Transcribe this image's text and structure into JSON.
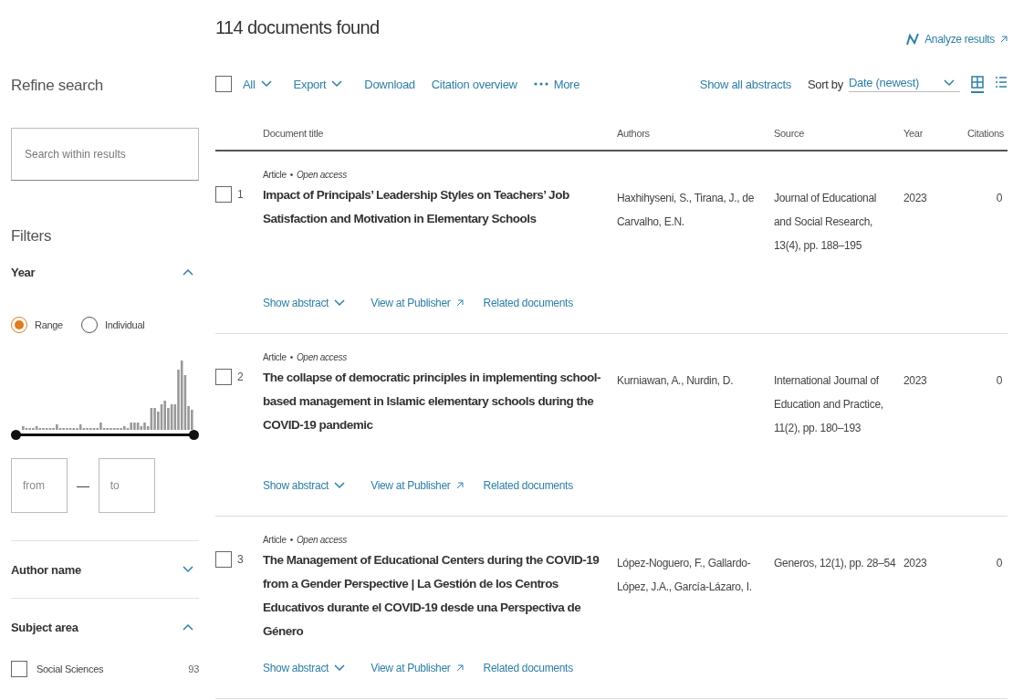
{
  "header": {
    "count": "114 documents found",
    "analyze": "Analyze results"
  },
  "sidebar": {
    "title": "Refine search",
    "search": {
      "placeholder": "Search within results"
    },
    "filters_title": "Filters",
    "year": {
      "label": "Year",
      "expanded": true,
      "modes": [
        {
          "label": "Range",
          "selected": true
        },
        {
          "label": "Individual",
          "selected": false
        }
      ],
      "from": {
        "placeholder": "from"
      },
      "dash": "—",
      "to": {
        "placeholder": "to"
      }
    },
    "slider": {
      "level": 1
    },
    "sections": [
      {
        "label": "Author name",
        "expanded": false
      },
      {
        "label": "Subject area",
        "expanded": true
      }
    ],
    "subjects": [
      {
        "label": "Social Sciences",
        "count": "93",
        "checked": false
      }
    ]
  },
  "toolbar": {
    "select_all": {
      "checked": false
    },
    "all": "All",
    "export": "Export",
    "download": "Download",
    "citation_overview": "Citation overview",
    "more": "More",
    "show_all_abstracts": "Show all abstracts",
    "sort_label": "Sort by",
    "sort_value": "Date (newest)",
    "view_modes": [
      {
        "kind": "grid",
        "selected": true
      },
      {
        "kind": "list",
        "selected": false
      }
    ]
  },
  "table": {
    "columns": [
      "Document title",
      "Authors",
      "Source",
      "Year",
      "Citations"
    ],
    "rows": [
      {
        "number": "1",
        "checked": false,
        "type": "Article",
        "separator": "•",
        "access": "Open access",
        "title": "Impact of Principals’ Leadership Styles on Teachers’ Job Satisfaction and Motivation in Elementary Schools",
        "authors": "Haxhihyseni, S., Tirana, J., de Carvalho, E.N.",
        "source": "Journal of Educational and Social Research, 13(4), pp. 188–195",
        "year": "2023",
        "citations": "0",
        "links": [
          "Show abstract",
          "View at Publisher",
          "Related documents"
        ]
      },
      {
        "number": "2",
        "checked": false,
        "type": "Article",
        "separator": "•",
        "access": "Open access",
        "title": "The collapse of democratic principles in implementing school-based management in Islamic elementary schools during the COVID-19 pandemic",
        "authors": "Kurniawan, A., Nurdin, D.",
        "source": "International Journal of Education and Practice, 11(2), pp. 180–193",
        "year": "2023",
        "citations": "0",
        "links": [
          "Show abstract",
          "View at Publisher",
          "Related documents"
        ]
      },
      {
        "number": "3",
        "checked": false,
        "type": "Article",
        "separator": "•",
        "access": "Open access",
        "title": "The Management of Educational Centers during the COVID-19 from a Gender Perspective | La Gestión de los Centros Educativos durante el COVID-19 desde una Perspectiva de Género",
        "authors": "López-Noguero, F., Gallardo-López, J.A., García-Lázaro, I.",
        "source": "Generos, 12(1), pp. 28–54",
        "year": "2023",
        "citations": "0",
        "links": [
          "Show abstract",
          "View at Publisher",
          "Related documents"
        ]
      }
    ]
  }
}
